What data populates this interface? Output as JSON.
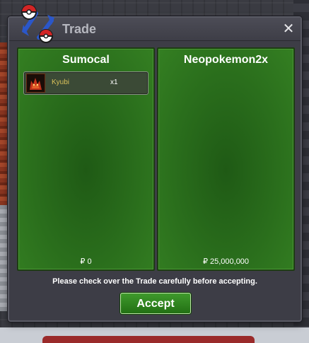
{
  "window": {
    "title": "Trade",
    "close_icon": "close-icon",
    "title_icon": "trade-pokeball-swap-icon"
  },
  "left_panel": {
    "player_name": "Sumocal",
    "items": [
      {
        "name": "Kyubi",
        "quantity": "x1",
        "icon": "kyubi-sprite-icon"
      }
    ],
    "money": "₽ 0"
  },
  "right_panel": {
    "player_name": "Neopokemon2x",
    "items": [],
    "money": "₽ 25,000,000"
  },
  "notice": "Please check over the Trade carefully before accepting.",
  "accept_label": "Accept",
  "colors": {
    "panel_green": "#2a6e1c",
    "accept_green": "#2e8a1c",
    "window_bg": "#3d3d46",
    "item_name": "#d9c15a"
  }
}
